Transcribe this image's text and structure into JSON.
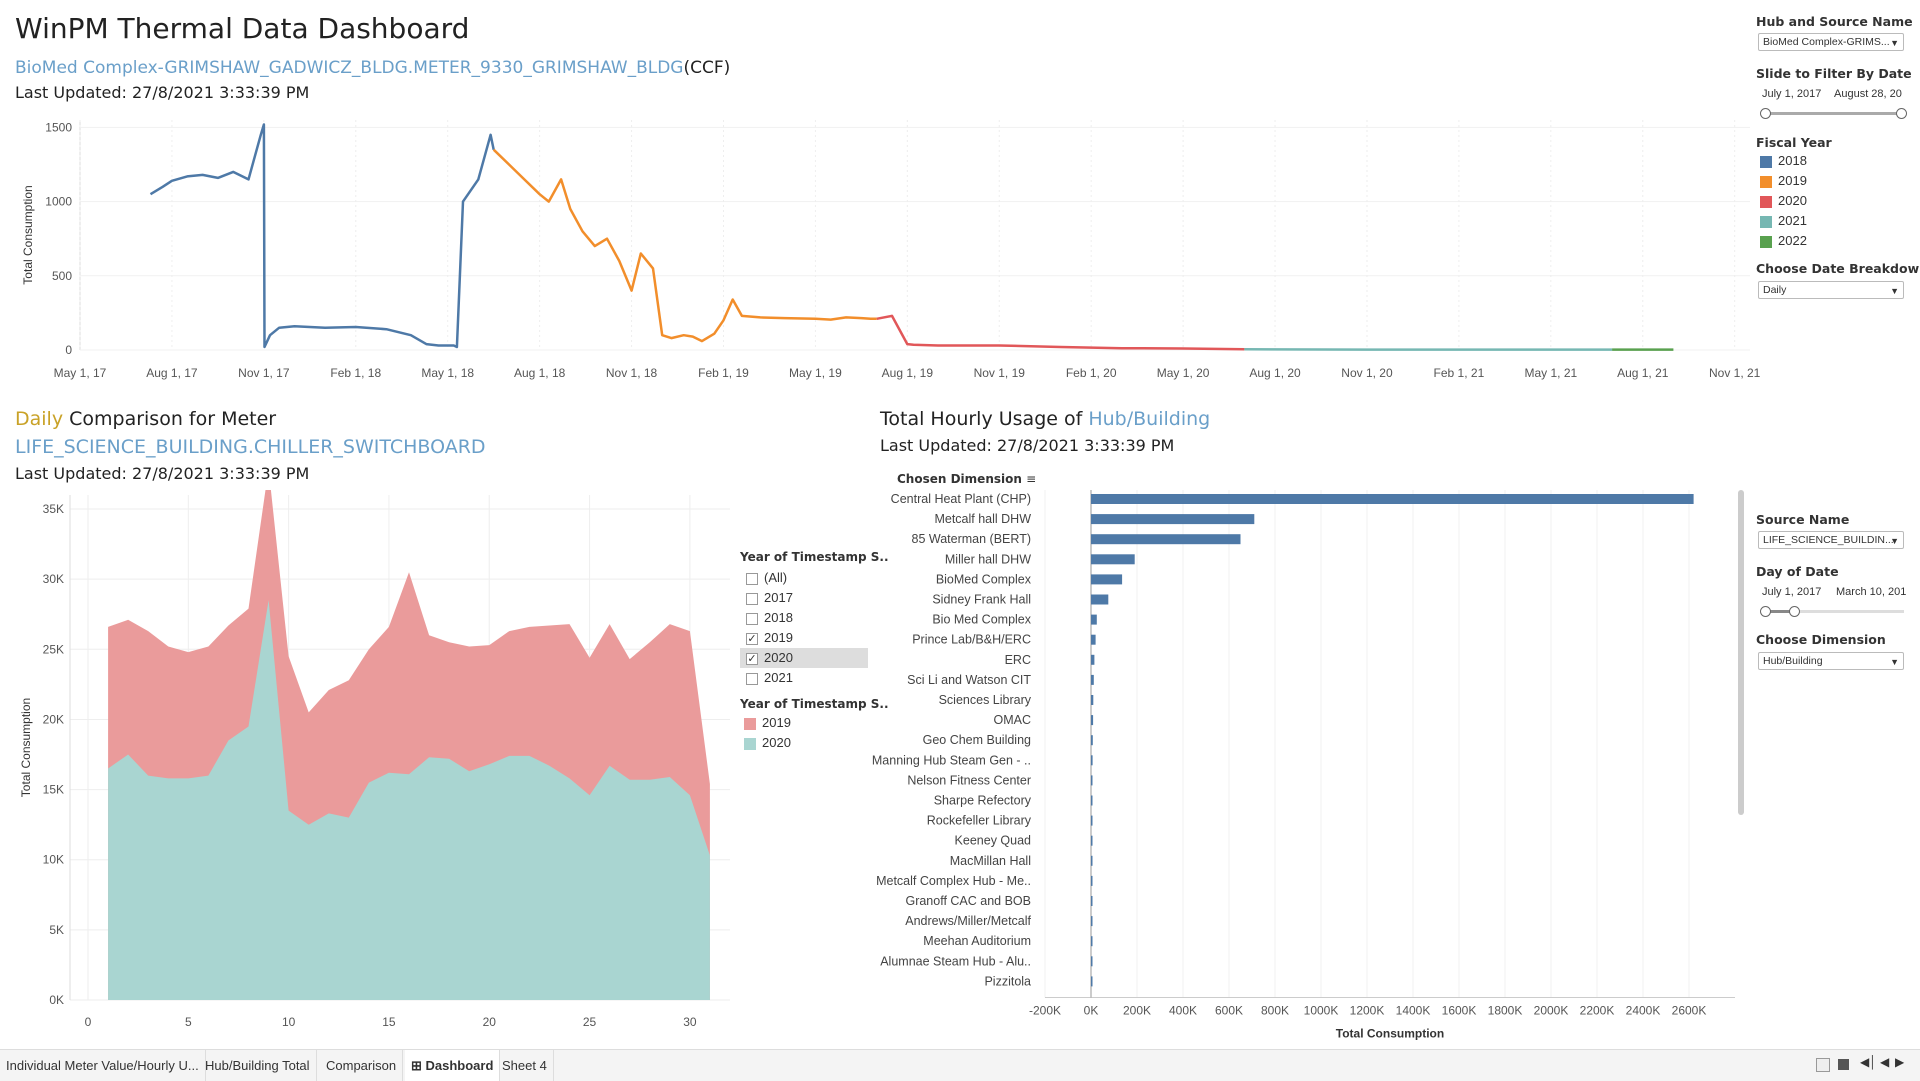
{
  "header": {
    "title": "WinPM Thermal Data Dashboard",
    "meter_name": "BioMed Complex-GRIMSHAW_GADWICZ_BLDG.METER_9330_GRIMSHAW_BLDG",
    "meter_unit": "(CCF)",
    "last_updated": "Last Updated: 27/8/2021 3:33:39 PM"
  },
  "top_chart": {
    "ylabel": "Total Consumption",
    "yticks": [
      "0",
      "500",
      "1000",
      "1500"
    ],
    "xticks": [
      "May 1, 17",
      "Aug 1, 17",
      "Nov 1, 17",
      "Feb 1, 18",
      "May 1, 18",
      "Aug 1, 18",
      "Nov 1, 18",
      "Feb 1, 19",
      "May 1, 19",
      "Aug 1, 19",
      "Nov 1, 19",
      "Feb 1, 20",
      "May 1, 20",
      "Aug 1, 20",
      "Nov 1, 20",
      "Feb 1, 21",
      "May 1, 21",
      "Aug 1, 21",
      "Nov 1, 21"
    ]
  },
  "comparison": {
    "breakdown": "Daily",
    "title_rest": " Comparison for Meter",
    "meter": "LIFE_SCIENCE_BUILDING.CHILLER_SWITCHBOARD",
    "last_updated": "Last Updated: 27/8/2021 3:33:39 PM",
    "ylabel": "Total Consumption",
    "yticks": [
      "0K",
      "5K",
      "10K",
      "15K",
      "20K",
      "25K",
      "30K",
      "35K"
    ],
    "xticks": [
      "0",
      "5",
      "10",
      "15",
      "20",
      "25",
      "30"
    ],
    "filter_title": "Year of Timestamp S..",
    "filter_items": [
      {
        "label": "(All)",
        "checked": false
      },
      {
        "label": "2017",
        "checked": false
      },
      {
        "label": "2018",
        "checked": false
      },
      {
        "label": "2019",
        "checked": true
      },
      {
        "label": "2020",
        "checked": true
      },
      {
        "label": "2021",
        "checked": false
      }
    ],
    "legend_title": "Year of Timestamp S..",
    "legend": [
      {
        "label": "2019",
        "color": "#ea9b9b"
      },
      {
        "label": "2020",
        "color": "#a9d5d1"
      }
    ]
  },
  "hourly": {
    "title_prefix": "Total Hourly Usage of ",
    "title_dim": "Hub/Building",
    "last_updated": "Last Updated: 27/8/2021 3:33:39 PM",
    "dim_header": "Chosen Dimension",
    "xlabel": "Total Consumption",
    "xticks": [
      "-200K",
      "0K",
      "200K",
      "400K",
      "600K",
      "800K",
      "1000K",
      "1200K",
      "1400K",
      "1600K",
      "1800K",
      "2000K",
      "2200K",
      "2400K",
      "2600K"
    ]
  },
  "right_panel": {
    "hub_source_label": "Hub and Source Name",
    "hub_source_value": "BioMed Complex-GRIMS...",
    "slide_label": "Slide to Filter By Date",
    "slide_start": "July 1, 2017",
    "slide_end": "August 28, 20",
    "fiscal_label": "Fiscal Year",
    "fiscal_years": [
      {
        "label": "2018",
        "color": "#4e79a7"
      },
      {
        "label": "2019",
        "color": "#f28e2b"
      },
      {
        "label": "2020",
        "color": "#e15759"
      },
      {
        "label": "2021",
        "color": "#76b7b2"
      },
      {
        "label": "2022",
        "color": "#59a14f"
      }
    ],
    "breakdown_label": "Choose Date Breakdown",
    "breakdown_value": "Daily",
    "source_name_label": "Source Name",
    "source_name_value": "LIFE_SCIENCE_BUILDIN...",
    "day_label": "Day of Date",
    "day_start": "July 1, 2017",
    "day_end": "March 10, 201",
    "dimension_label": "Choose Dimension",
    "dimension_value": "Hub/Building"
  },
  "tabs": [
    {
      "label": "Individual Meter Value/Hourly U..."
    },
    {
      "label": "Hub/Building Total"
    },
    {
      "label": "Comparison"
    },
    {
      "label": "Dashboard"
    },
    {
      "label": "Sheet 4"
    }
  ],
  "chart_data": [
    {
      "type": "line",
      "title": "",
      "ylabel": "Total Consumption",
      "ylim": [
        0,
        1550
      ],
      "x_units": "month index from May 1, 2017",
      "series": [
        {
          "name": "2018",
          "color": "#4e79a7",
          "x": [
            2.3,
            2.7,
            3.0,
            3.5,
            4.0,
            4.5,
            5.0,
            5.5,
            5.9,
            6.0,
            6.02,
            6.2,
            6.5,
            7.0,
            8.0,
            9.0,
            10.0,
            10.8,
            11.3,
            11.7,
            12.2,
            12.3,
            12.5,
            13.0,
            13.4,
            13.5
          ],
          "y": [
            1050,
            1100,
            1140,
            1170,
            1180,
            1160,
            1200,
            1150,
            1450,
            1520,
            20,
            100,
            150,
            160,
            150,
            155,
            140,
            100,
            40,
            30,
            30,
            20,
            1000,
            1150,
            1450,
            1350
          ]
        },
        {
          "name": "2019",
          "color": "#f28e2b",
          "x": [
            13.5,
            14.0,
            14.5,
            15.0,
            15.3,
            15.7,
            16.0,
            16.4,
            16.8,
            17.2,
            17.6,
            18.0,
            18.3,
            18.7,
            19.0,
            19.3,
            19.7,
            20.0,
            20.3,
            20.7,
            21.0,
            21.3,
            21.6,
            22.2,
            23.0,
            24.0,
            24.5,
            25.0,
            25.5,
            25.8,
            26.0
          ],
          "y": [
            1350,
            1250,
            1150,
            1050,
            1000,
            1150,
            950,
            800,
            700,
            750,
            600,
            400,
            650,
            550,
            100,
            80,
            100,
            90,
            60,
            110,
            200,
            340,
            230,
            220,
            215,
            210,
            205,
            220,
            215,
            210,
            210
          ]
        },
        {
          "name": "2020",
          "color": "#e15759",
          "x": [
            26.0,
            26.5,
            27.0,
            27.2,
            28.0,
            30.0,
            32.0,
            34.0,
            36.0,
            38.0
          ],
          "y": [
            210,
            230,
            40,
            35,
            30,
            30,
            20,
            12,
            10,
            5
          ]
        },
        {
          "name": "2021",
          "color": "#76b7b2",
          "x": [
            38.0,
            42.0,
            46.0,
            50.0
          ],
          "y": [
            5,
            3,
            3,
            3
          ]
        },
        {
          "name": "2022",
          "color": "#59a14f",
          "x": [
            50.0,
            52.0
          ],
          "y": [
            3,
            3
          ]
        }
      ]
    },
    {
      "type": "area",
      "title": "",
      "ylabel": "Total Consumption",
      "ylim": [
        0,
        36000
      ],
      "x": [
        1,
        2,
        3,
        4,
        5,
        6,
        7,
        8,
        9,
        10,
        11,
        12,
        13,
        14,
        15,
        16,
        17,
        18,
        19,
        20,
        21,
        22,
        23,
        24,
        25,
        26,
        27,
        28,
        29,
        30,
        31
      ],
      "series": [
        {
          "name": "2020",
          "color": "#a9d5d1",
          "values": [
            16500,
            17500,
            16000,
            15800,
            15800,
            16000,
            18500,
            19500,
            28500,
            13500,
            12500,
            13300,
            13000,
            15500,
            16200,
            16100,
            17300,
            17200,
            16300,
            16800,
            17400,
            17400,
            16700,
            15800,
            14600,
            16700,
            15700,
            15700,
            15900,
            14600,
            10300
          ]
        },
        {
          "name": "2019",
          "color": "#ea9b9b",
          "values": [
            26600,
            27100,
            26300,
            25200,
            24800,
            25200,
            26700,
            27900,
            37900,
            24500,
            20500,
            22100,
            22800,
            25000,
            26600,
            30500,
            26000,
            25500,
            25200,
            25300,
            26300,
            26600,
            26700,
            26800,
            24400,
            26800,
            24300,
            25500,
            26800,
            26300,
            15400
          ]
        }
      ]
    },
    {
      "type": "bar",
      "title": "",
      "xlabel": "Total Consumption",
      "xlim": [
        -200000,
        2800000
      ],
      "categories": [
        "Central Heat Plant (CHP)",
        "Metcalf hall DHW",
        "85 Waterman (BERT)",
        "Miller hall DHW",
        "BioMed Complex",
        "Sidney Frank Hall",
        "Bio Med Complex",
        "Prince Lab/B&H/ERC",
        "ERC",
        "Sci Li and Watson CIT",
        "Sciences Library",
        "OMAC",
        "Geo Chem Building",
        "Manning Hub Steam Gen - ..",
        "Nelson Fitness Center",
        "Sharpe Refectory",
        "Rockefeller Library",
        "Keeney Quad",
        "MacMillan Hall",
        "Metcalf Complex Hub - Me..",
        "Granoff CAC and BOB",
        "Andrews/Miller/Metcalf",
        "Meehan Auditorium",
        "Alumnae Steam Hub - Alu..",
        "Pizzitola"
      ],
      "values": [
        2620000,
        710000,
        650000,
        190000,
        135000,
        75000,
        25000,
        20000,
        15000,
        12000,
        10000,
        9000,
        8000,
        7000,
        6000,
        5000,
        4500,
        4000,
        3500,
        3000,
        2500,
        2000,
        1800,
        1500,
        1200
      ],
      "color": "#4e79a7"
    }
  ]
}
